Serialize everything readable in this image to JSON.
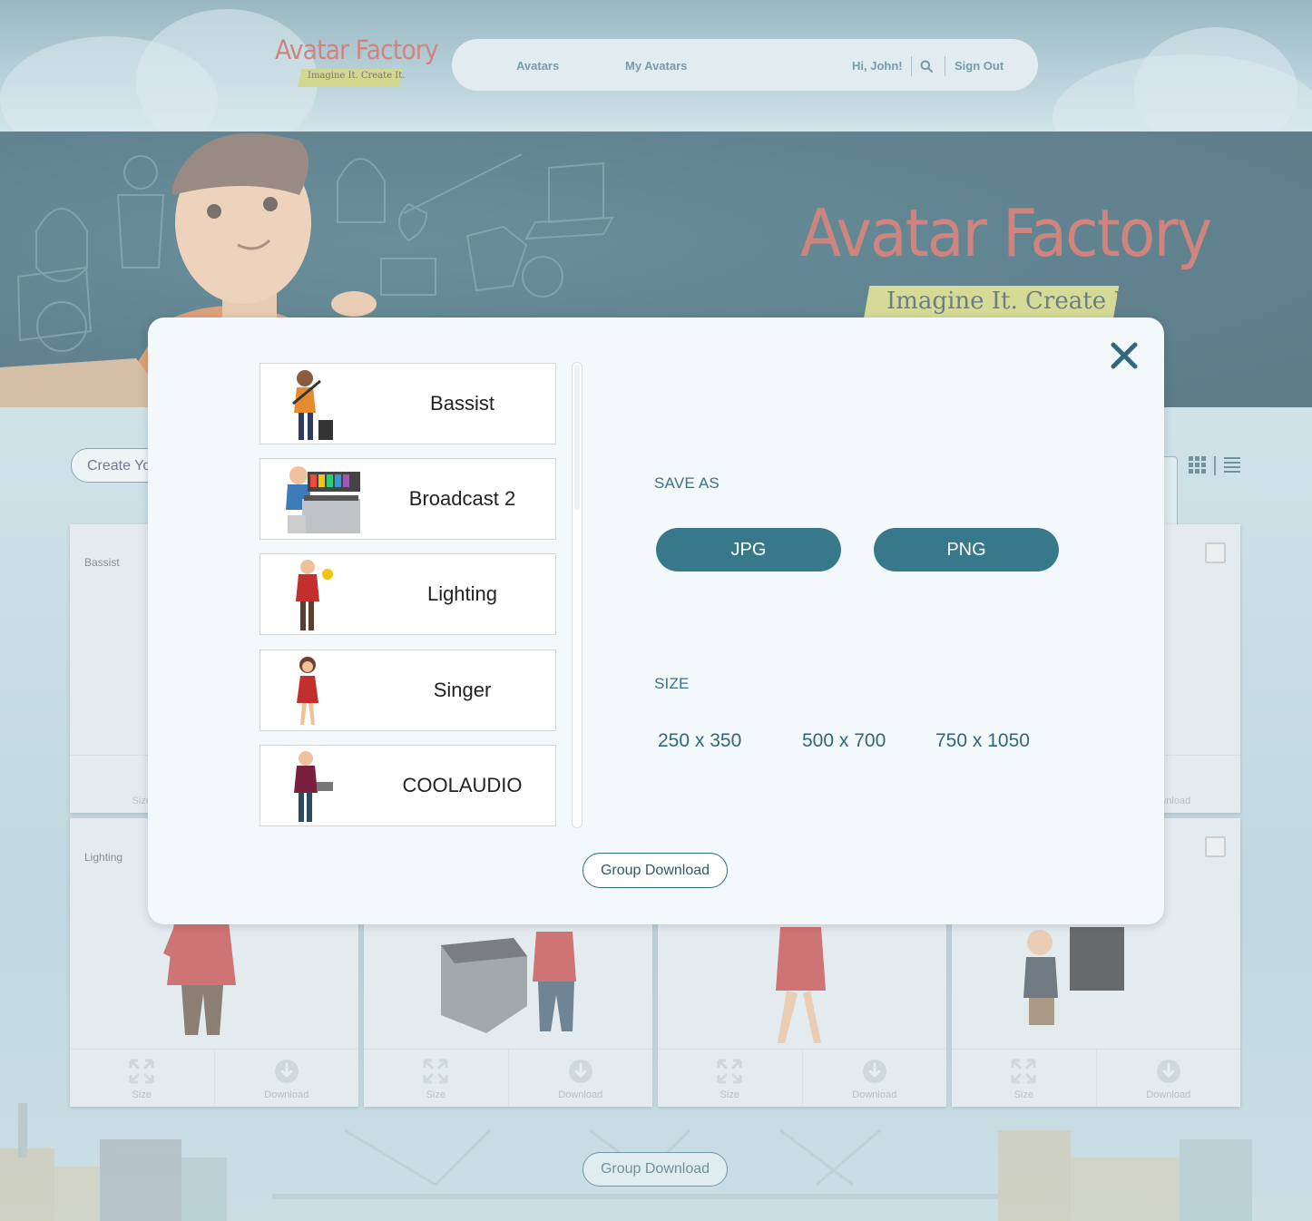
{
  "header": {
    "logo_title": "Avatar Factory",
    "logo_tagline": "Imagine It. Create It.",
    "nav": {
      "avatars": "Avatars",
      "my_avatars": "My Avatars",
      "greeting": "Hi, John!",
      "sign_out": "Sign Out"
    }
  },
  "hero": {
    "title": "Avatar Factory",
    "tagline": "Imagine It. Create It."
  },
  "page": {
    "create_button": "Create Yo",
    "cards": [
      {
        "title": "Bassist"
      },
      {
        "title": "Lighting"
      }
    ],
    "card_actions": {
      "size": "Size",
      "download": "Download"
    },
    "group_download": "Group Download"
  },
  "modal": {
    "items": [
      {
        "name": "Bassist"
      },
      {
        "name": "Broadcast 2"
      },
      {
        "name": "Lighting"
      },
      {
        "name": "Singer"
      },
      {
        "name": "COOLAUDIO"
      }
    ],
    "save_as_label": "SAVE AS",
    "formats": [
      "JPG",
      "PNG"
    ],
    "size_label": "SIZE",
    "sizes": [
      "250 x 350",
      "500 x 700",
      "750 x 1050"
    ],
    "group_download": "Group Download"
  },
  "colors": {
    "brand_red": "#c14b3e",
    "accent_teal": "#37788b",
    "hero_bg": "#17475a"
  }
}
